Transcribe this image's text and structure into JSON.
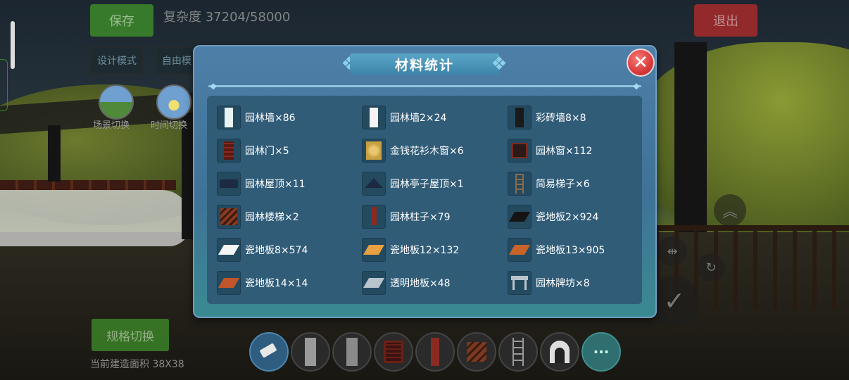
{
  "hud": {
    "save_label": "保存",
    "complexity": "复杂度 37204/58000",
    "exit_label": "退出",
    "design_mode": "设计模式",
    "free_mode": "自由模",
    "scene_switch": "场景切换",
    "time_switch": "时间切换",
    "spec_switch": "规格切换",
    "build_area": "当前建造面积 38X38"
  },
  "dialog": {
    "title": "材料统计",
    "close_symbol": "✕",
    "items": [
      {
        "label": "园林墙×86",
        "icon": "garden-wall-icon"
      },
      {
        "label": "园林墙2×24",
        "icon": "garden-wall-2-icon"
      },
      {
        "label": "彩砖墙8×8",
        "icon": "colored-brick-wall-icon"
      },
      {
        "label": "园林门×5",
        "icon": "garden-door-icon"
      },
      {
        "label": "金钱花衫木窗×6",
        "icon": "wooden-window-icon"
      },
      {
        "label": "园林窗×112",
        "icon": "garden-window-icon"
      },
      {
        "label": "园林屋顶×11",
        "icon": "garden-roof-icon"
      },
      {
        "label": "园林亭子屋顶×1",
        "icon": "pavilion-roof-icon"
      },
      {
        "label": "简易梯子×6",
        "icon": "ladder-icon"
      },
      {
        "label": "园林楼梯×2",
        "icon": "stairs-icon"
      },
      {
        "label": "园林柱子×79",
        "icon": "pillar-icon"
      },
      {
        "label": "瓷地板2×924",
        "icon": "tile-floor-2-icon"
      },
      {
        "label": "瓷地板8×574",
        "icon": "tile-floor-8-icon"
      },
      {
        "label": "瓷地板12×132",
        "icon": "tile-floor-12-icon"
      },
      {
        "label": "瓷地板13×905",
        "icon": "tile-floor-13-icon"
      },
      {
        "label": "瓷地板14×14",
        "icon": "tile-floor-14-icon"
      },
      {
        "label": "透明地板×48",
        "icon": "transparent-floor-icon"
      },
      {
        "label": "园林牌坊×8",
        "icon": "archway-icon"
      }
    ]
  },
  "toolbar": {
    "tools": [
      "eraser-icon",
      "wall-icon",
      "wall-2-icon",
      "window-icon",
      "pillar-icon",
      "stairs-icon",
      "ladder-icon",
      "arch-door-icon",
      "more-icon"
    ],
    "more_label": "···"
  },
  "colors": {
    "dialog_top": "#4d7fa8",
    "dialog_bottom": "#3a8a92",
    "panel": "#305c78",
    "close": "#d83a3a",
    "save_green": "#3f8f2a",
    "exit_red": "#b02a2a"
  }
}
